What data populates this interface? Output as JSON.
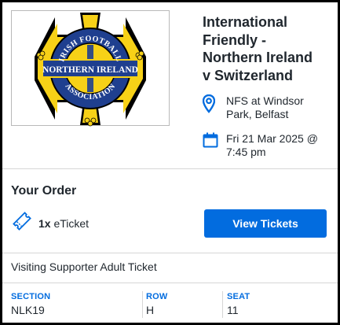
{
  "event": {
    "title": "International Friendly - Northern Ireland v Switzerland",
    "title_lines": [
      "International",
      "Friendly -",
      "Northern Ireland",
      "v Switzerland"
    ],
    "logo": {
      "top_text": "IRISH FOOTBALL",
      "center_text": "NORTHERN IRELAND",
      "bottom_text": "ASSOCIATION",
      "colors": {
        "blue": "#1f3f8f",
        "yellow": "#f7d117",
        "black": "#000000"
      }
    },
    "venue": {
      "icon": "map-pin-icon",
      "line1": "NFS at Windsor",
      "line2": "Park, Belfast"
    },
    "date": {
      "icon": "calendar-icon",
      "line1": "Fri 21 Mar 2025 @",
      "line2": "7:45 pm"
    }
  },
  "order": {
    "heading": "Your Order",
    "ticket_icon": "ticket-icon",
    "quantity": "1x",
    "ticket_kind": "eTicket",
    "view_button": "View Tickets",
    "ticket_type": "Visiting Supporter Adult Ticket"
  },
  "seat": {
    "section_label": "SECTION",
    "section_value": "NLK19",
    "row_label": "ROW",
    "row_value": "H",
    "seat_label": "SEAT",
    "seat_value": "11"
  },
  "colors": {
    "accent": "#026cdf",
    "text": "#1f262d",
    "divider": "#d6d6d6"
  }
}
